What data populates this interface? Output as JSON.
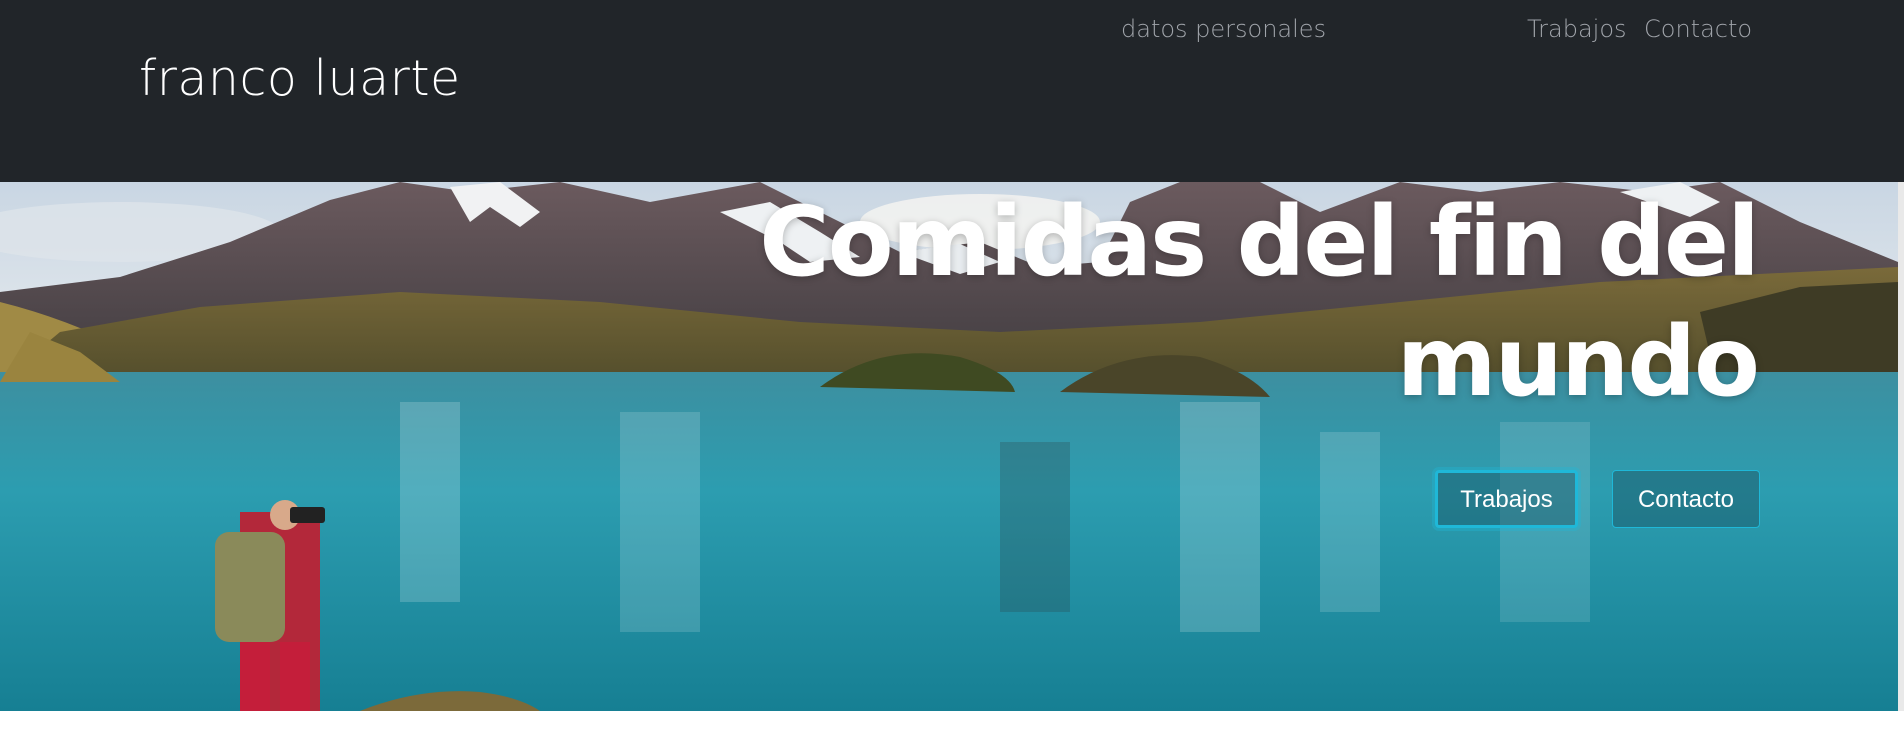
{
  "navbar": {
    "brand": "franco luarte",
    "links": [
      {
        "label": "datos personales"
      },
      {
        "label": "Trabajos"
      },
      {
        "label": "Contacto"
      }
    ]
  },
  "hero": {
    "title": "Comidas del fin del mundo",
    "buttons": [
      {
        "label": "Trabajos"
      },
      {
        "label": "Contacto"
      }
    ]
  },
  "colors": {
    "navbar_bg": "#212529",
    "brand_text": "#ffffff",
    "nav_link": "#a0a4aa",
    "button_border": "#1fb8d8",
    "lake": "#2f96a8"
  }
}
